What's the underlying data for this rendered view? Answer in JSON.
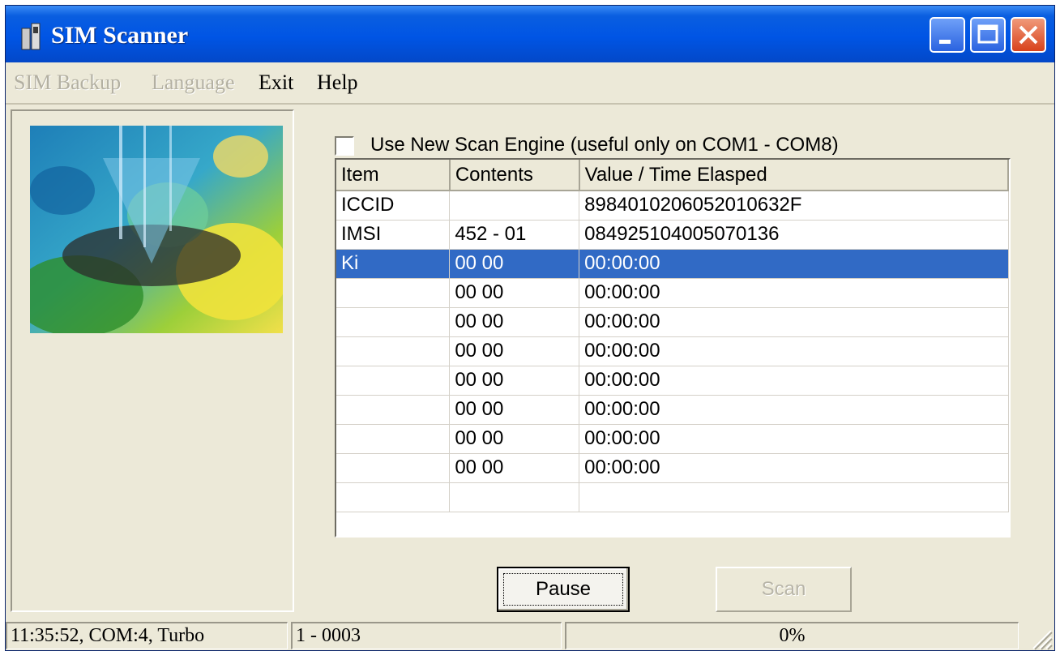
{
  "window": {
    "title": "SIM Scanner"
  },
  "menu": [
    {
      "label": "SIM Backup",
      "enabled": false
    },
    {
      "label": "Language",
      "enabled": false
    },
    {
      "label": "Exit",
      "enabled": true
    },
    {
      "label": "Help",
      "enabled": true
    }
  ],
  "scan_option": {
    "label": "Use New Scan Engine (useful only on COM1 - COM8)",
    "checked": false
  },
  "table": {
    "columns": [
      "Item",
      "Contents",
      "Value / Time Elasped"
    ],
    "rows": [
      {
        "item": "ICCID",
        "contents": "",
        "value": "8984010206052010632F",
        "selected": false
      },
      {
        "item": "IMSI",
        "contents": "452 - 01",
        "value": "084925104005070136",
        "selected": false
      },
      {
        "item": "Ki",
        "contents": "00 00",
        "value": "00:00:00",
        "selected": true
      },
      {
        "item": "",
        "contents": "00 00",
        "value": "00:00:00",
        "selected": false
      },
      {
        "item": "",
        "contents": "00 00",
        "value": "00:00:00",
        "selected": false
      },
      {
        "item": "",
        "contents": "00 00",
        "value": "00:00:00",
        "selected": false
      },
      {
        "item": "",
        "contents": "00 00",
        "value": "00:00:00",
        "selected": false
      },
      {
        "item": "",
        "contents": "00 00",
        "value": "00:00:00",
        "selected": false
      },
      {
        "item": "",
        "contents": "00 00",
        "value": "00:00:00",
        "selected": false
      },
      {
        "item": "",
        "contents": "00 00",
        "value": "00:00:00",
        "selected": false
      },
      {
        "item": "",
        "contents": "",
        "value": "",
        "selected": false
      }
    ]
  },
  "buttons": {
    "pause": "Pause",
    "scan": "Scan"
  },
  "status": {
    "time_port": "11:35:52, COM:4, Turbo",
    "range": "1 - 0003",
    "progress": "0%"
  },
  "colors": {
    "title_bar": "#0055e5",
    "selection": "#316ac5",
    "face": "#ece9d8"
  },
  "icons": [
    "app-icon",
    "minimize-icon",
    "maximize-icon",
    "close-icon",
    "size-grip-icon"
  ]
}
